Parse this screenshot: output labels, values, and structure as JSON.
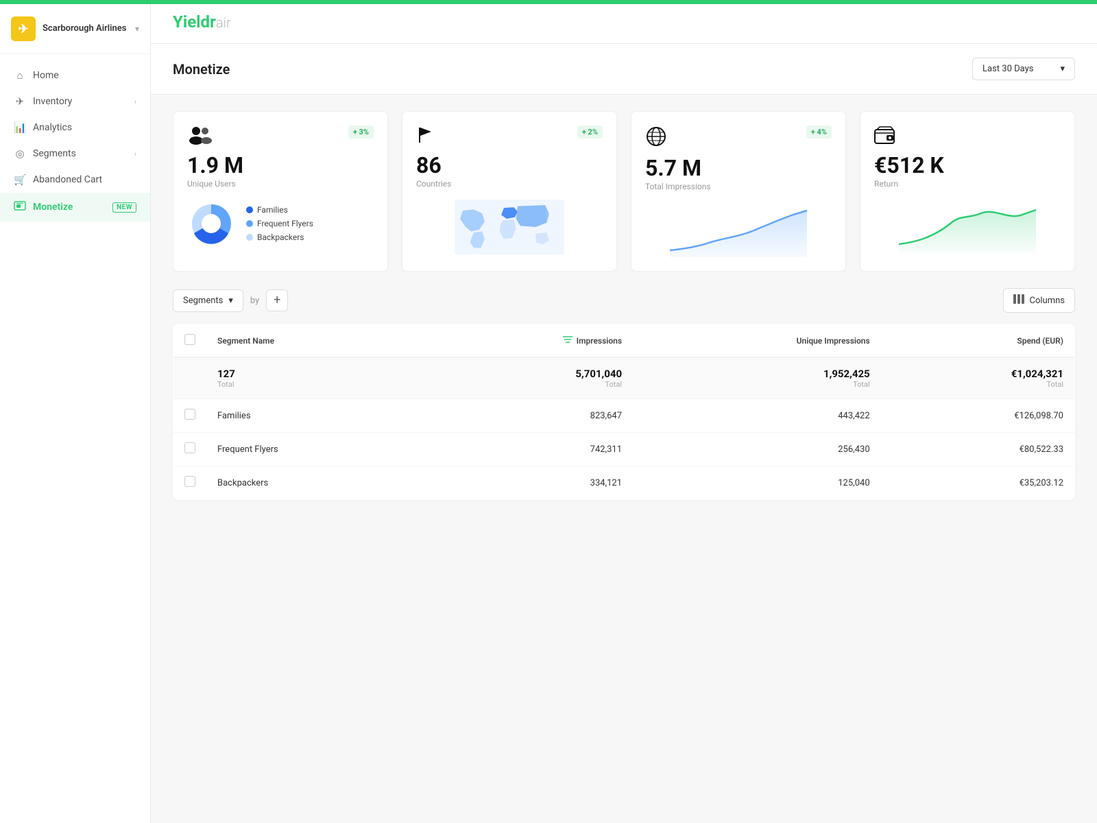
{
  "app": {
    "name": "Yieldr",
    "name_suffix": "air",
    "top_bar_color": "#2ecc71"
  },
  "sidebar": {
    "company": "Scarborough Airlines",
    "logo_letter": "✈",
    "items": [
      {
        "id": "home",
        "label": "Home",
        "icon": "🏠",
        "has_arrow": false,
        "active": false
      },
      {
        "id": "inventory",
        "label": "Inventory",
        "icon": "✈",
        "has_arrow": true,
        "active": false
      },
      {
        "id": "analytics",
        "label": "Analytics",
        "icon": "📊",
        "has_arrow": false,
        "active": false
      },
      {
        "id": "segments",
        "label": "Segments",
        "icon": "⬡",
        "has_arrow": true,
        "active": false
      },
      {
        "id": "abandoned-cart",
        "label": "Abandoned Cart",
        "icon": "🛒",
        "has_arrow": false,
        "active": false
      },
      {
        "id": "monetize",
        "label": "Monetize",
        "icon": "💳",
        "has_arrow": false,
        "active": true,
        "badge": "NEW"
      }
    ]
  },
  "page": {
    "title": "Monetize",
    "date_filter": "Last 30 Days"
  },
  "stats_cards": [
    {
      "id": "unique-users",
      "icon": "👥",
      "badge": "+ 3%",
      "value": "1.9 M",
      "label": "Unique Users",
      "chart_type": "pie",
      "legend": [
        {
          "label": "Families",
          "color": "#2563eb"
        },
        {
          "label": "Frequent Flyers",
          "color": "#60a5fa"
        },
        {
          "label": "Backpackers",
          "color": "#bfdbfe"
        }
      ]
    },
    {
      "id": "countries",
      "icon": "🚩",
      "badge": "+ 2%",
      "value": "86",
      "label": "Countries",
      "chart_type": "map"
    },
    {
      "id": "total-impressions",
      "icon": "🌐",
      "badge": "+ 4%",
      "value": "5.7 M",
      "label": "Total Impressions",
      "chart_type": "line_blue"
    },
    {
      "id": "return",
      "icon": "💳",
      "badge": "",
      "value": "€512 K",
      "label": "Return",
      "chart_type": "line_green"
    }
  ],
  "table": {
    "segments_dropdown_label": "Segments",
    "by_label": "by",
    "add_btn_label": "+",
    "columns_btn_label": "Columns",
    "headers": [
      {
        "id": "checkbox",
        "label": ""
      },
      {
        "id": "segment-name",
        "label": "Segment Name"
      },
      {
        "id": "impressions",
        "label": "Impressions",
        "has_filter": true
      },
      {
        "id": "unique-impressions",
        "label": "Unique Impressions"
      },
      {
        "id": "spend",
        "label": "Spend (EUR)"
      }
    ],
    "totals": {
      "count": "127",
      "count_label": "Total",
      "impressions": "5,701,040",
      "impressions_label": "Total",
      "unique_impressions": "1,952,425",
      "unique_impressions_label": "Total",
      "spend": "€1,024,321",
      "spend_label": "Total"
    },
    "rows": [
      {
        "name": "Families",
        "impressions": "823,647",
        "unique_impressions": "443,422",
        "spend": "€126,098.70"
      },
      {
        "name": "Frequent Flyers",
        "impressions": "742,311",
        "unique_impressions": "256,430",
        "spend": "€80,522.33"
      },
      {
        "name": "Backpackers",
        "impressions": "334,121",
        "unique_impressions": "125,040",
        "spend": "€35,203.12"
      }
    ]
  }
}
